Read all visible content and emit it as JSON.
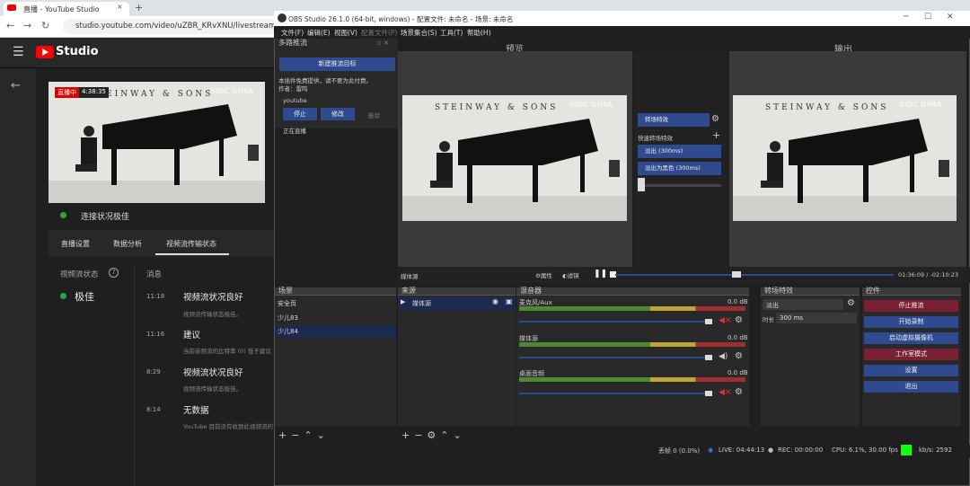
{
  "browser": {
    "tab_title": "直播 - YouTube Studio",
    "tab_close": "×",
    "new_tab": "+",
    "url": "studio.youtube.com/video/uZBR_KRvXNU/livestreaming"
  },
  "studio": {
    "logo_text": "Studio",
    "live_badge": "直播中",
    "live_time": "4:38:35",
    "connection_status": "连接状况极佳",
    "tabs": [
      "直播设置",
      "数据分析",
      "视频流传输状态"
    ],
    "health_label": "视频流状态",
    "health_value": "极佳",
    "messages_header": "消息",
    "messages": [
      {
        "time": "11:18",
        "title": "视频流状况良好",
        "desc": "视频流传输状态极佳。"
      },
      {
        "time": "11:16",
        "title": "建议",
        "desc": "当前音频流的比特率 (0) 低于建议"
      },
      {
        "time": "8:29",
        "title": "视频流状况良好",
        "desc": "视频流传输状态极佳。"
      },
      {
        "time": "8:14",
        "title": "无数据",
        "desc": "YouTube 目前没有收到此视频流的"
      }
    ]
  },
  "video": {
    "brand_text": "STEINWAY & SONS",
    "logo_text": "SIDC GIMA"
  },
  "obs": {
    "title": "OBS Studio 26.1.0 (64-bit, windows) - 配置文件: 未命名 - 场景: 未命名",
    "menu": [
      "文件(F)",
      "编辑(E)",
      "视图(V)",
      "配置文件(P)",
      "场景集合(S)",
      "工具(T)",
      "帮助(H)"
    ],
    "source_dock_title": "多路推流",
    "new_target_btn": "新建推流目标",
    "plugin_note": "本插件免费提供，请不要为此付费。",
    "author": "作者：雷鸣",
    "target_name": "youtube",
    "stop_btn": "停止",
    "modify_btn": "修改",
    "delete_btn": "删除",
    "streaming_status": "正在直播",
    "preview_label": "预览",
    "output_label": "输出",
    "transition_btn": "转场特效",
    "quick_transitions": "快速转场特效",
    "fade_300": "淡出 (300ms)",
    "fade_black": "淡出为黑色 (300ms)",
    "media_source_label": "媒体源",
    "properties": "属性",
    "filters": "滤镜",
    "time_display": "01:36:09 / -02:10:23",
    "scenes_title": "场景",
    "scenes": [
      "安全页",
      "少儿83",
      "少儿84"
    ],
    "sources_title": "来源",
    "sources": [
      "媒体源"
    ],
    "mixer_title": "混音器",
    "mixer": [
      {
        "name": "麦克风/Aux",
        "db": "0.0 dB"
      },
      {
        "name": "媒体源",
        "db": "0.0 dB"
      },
      {
        "name": "桌面音频",
        "db": "0.0 dB"
      }
    ],
    "meter_ticks": [
      "-60",
      "-55",
      "-50",
      "-45",
      "-40",
      "-35",
      "-30",
      "-25",
      "-20",
      "-15",
      "-10",
      "-5",
      "0"
    ],
    "transitions_title": "转场特效",
    "transition_select": "淡出",
    "duration_label": "时长",
    "duration_value": "300 ms",
    "controls_title": "控件",
    "controls": [
      "停止推流",
      "开始录制",
      "启动虚拟摄像机",
      "工作室模式",
      "设置",
      "退出"
    ],
    "status": {
      "dropped": "丢帧 0 (0.0%)",
      "live": "LIVE: 04:44:13",
      "rec": "REC: 00:00:00",
      "cpu": "CPU: 6.1%, 30.00 fps",
      "kbps": "kb/s: 2592"
    },
    "colors": {
      "accent": "#2f4a8e",
      "stop_stream": "#7a2035",
      "studio_mode": "#7a2035",
      "live_green": "#22ee22"
    }
  }
}
